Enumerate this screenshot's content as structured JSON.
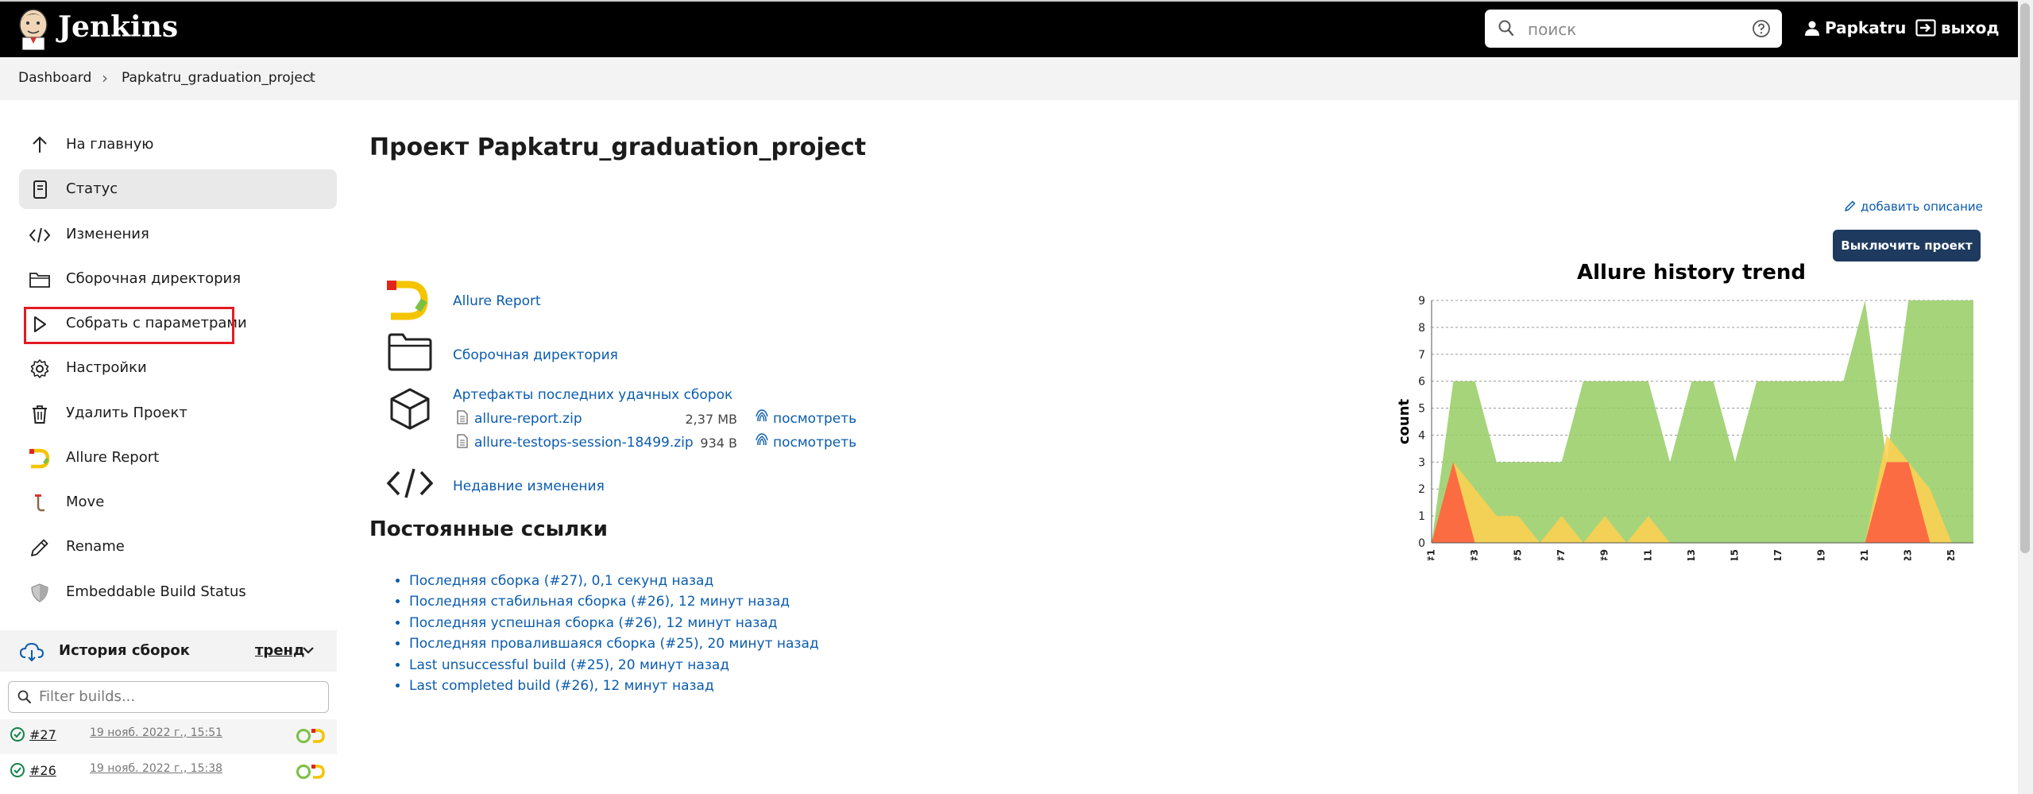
{
  "header": {
    "brand": "Jenkins",
    "search_placeholder": "поиск",
    "user": "Papkatru",
    "logout": "выход"
  },
  "breadcrumb": [
    "Dashboard",
    "Papkatru_graduation_project"
  ],
  "sidebar": {
    "items": [
      {
        "label": "На главную",
        "icon": "arrow-up-icon"
      },
      {
        "label": "Статус",
        "icon": "document-icon"
      },
      {
        "label": "Изменения",
        "icon": "code-icon"
      },
      {
        "label": "Сборочная директория",
        "icon": "folder-icon"
      },
      {
        "label": "Собрать с параметрами",
        "icon": "play-icon"
      },
      {
        "label": "Настройки",
        "icon": "gear-icon"
      },
      {
        "label": "Удалить Проект",
        "icon": "trash-icon"
      },
      {
        "label": "Allure Report",
        "icon": "allure-icon"
      },
      {
        "label": "Move",
        "icon": "move-icon"
      },
      {
        "label": "Rename",
        "icon": "pencil-icon"
      },
      {
        "label": "Embeddable Build Status",
        "icon": "shield-icon"
      }
    ],
    "active_index": 1,
    "highlighted_index": 4
  },
  "history": {
    "title": "История сборок",
    "trend": "тренд",
    "filter_placeholder": "Filter builds...",
    "builds": [
      {
        "num": "#27",
        "date": "19 нояб. 2022 г., 15:51"
      },
      {
        "num": "#26",
        "date": "19 нояб. 2022 г., 15:38"
      }
    ]
  },
  "main": {
    "title": "Проект Papkatru_graduation_project",
    "add_description": "добавить описание",
    "disable_button": "Выключить проект",
    "links": {
      "allure": "Allure Report",
      "workspace": "Сборочная директория",
      "artifacts": "Артефакты последних удачных сборок",
      "changes": "Недавние изменения"
    },
    "artifacts": [
      {
        "name": "allure-report.zip",
        "size": "2,37 MB",
        "view": "посмотреть"
      },
      {
        "name": "allure-testops-session-18499.zip",
        "size": "934 B",
        "view": "посмотреть"
      }
    ],
    "permalinks_title": "Постоянные ссылки",
    "permalinks": [
      "Последняя сборка (#27), 0,1 секунд назад",
      "Последняя стабильная сборка (#26), 12 минут назад",
      "Последняя успешная сборка (#26), 12 минут назад",
      "Последняя провалившаяся сборка (#25), 20 минут назад",
      "Last unsuccessful build (#25), 20 минут назад",
      "Last completed build (#26), 12 минут назад"
    ]
  },
  "colors": {
    "passed": "#97cc64",
    "broken": "#ffd050",
    "failed": "#fd5a3e",
    "link": "#0b5cad",
    "button": "#1e3a5f"
  },
  "chart_data": {
    "type": "area",
    "title": "Allure history trend",
    "ylabel": "count",
    "xlabel": "",
    "ylim": [
      0,
      9
    ],
    "yticks": [
      0,
      1,
      2,
      3,
      4,
      5,
      6,
      7,
      8,
      9
    ],
    "grid": true,
    "x": [
      "#1",
      "#2",
      "#3",
      "#4",
      "#5",
      "#6",
      "#7",
      "#8",
      "#9",
      "#10",
      "#11",
      "#12",
      "#13",
      "#14",
      "#15",
      "#16",
      "#17",
      "#18",
      "#19",
      "#20",
      "#21",
      "#22",
      "#23",
      "#24",
      "#25",
      "#26"
    ],
    "xtick_labels": [
      "#1",
      "#3",
      "#5",
      "#7",
      "#9",
      "#11",
      "#13",
      "#15",
      "#17",
      "#19",
      "#21",
      "#23",
      "#25"
    ],
    "series": [
      {
        "name": "passed",
        "color": "#97cc64",
        "values": [
          0,
          6,
          6,
          3,
          3,
          3,
          3,
          6,
          6,
          6,
          6,
          3,
          6,
          6,
          3,
          6,
          6,
          6,
          6,
          6,
          9,
          3,
          9,
          9,
          9,
          9
        ]
      },
      {
        "name": "broken",
        "color": "#ffd050",
        "values": [
          0,
          3,
          2,
          1,
          1,
          0,
          1,
          0,
          1,
          0,
          1,
          0,
          0,
          0,
          0,
          0,
          0,
          0,
          0,
          0,
          0,
          4,
          3,
          2,
          0,
          0
        ]
      },
      {
        "name": "failed",
        "color": "#fd5a3e",
        "values": [
          0,
          3,
          0,
          0,
          0,
          0,
          0,
          0,
          0,
          0,
          0,
          0,
          0,
          0,
          0,
          0,
          0,
          0,
          0,
          0,
          0,
          3,
          3,
          0,
          0,
          0
        ]
      }
    ]
  }
}
